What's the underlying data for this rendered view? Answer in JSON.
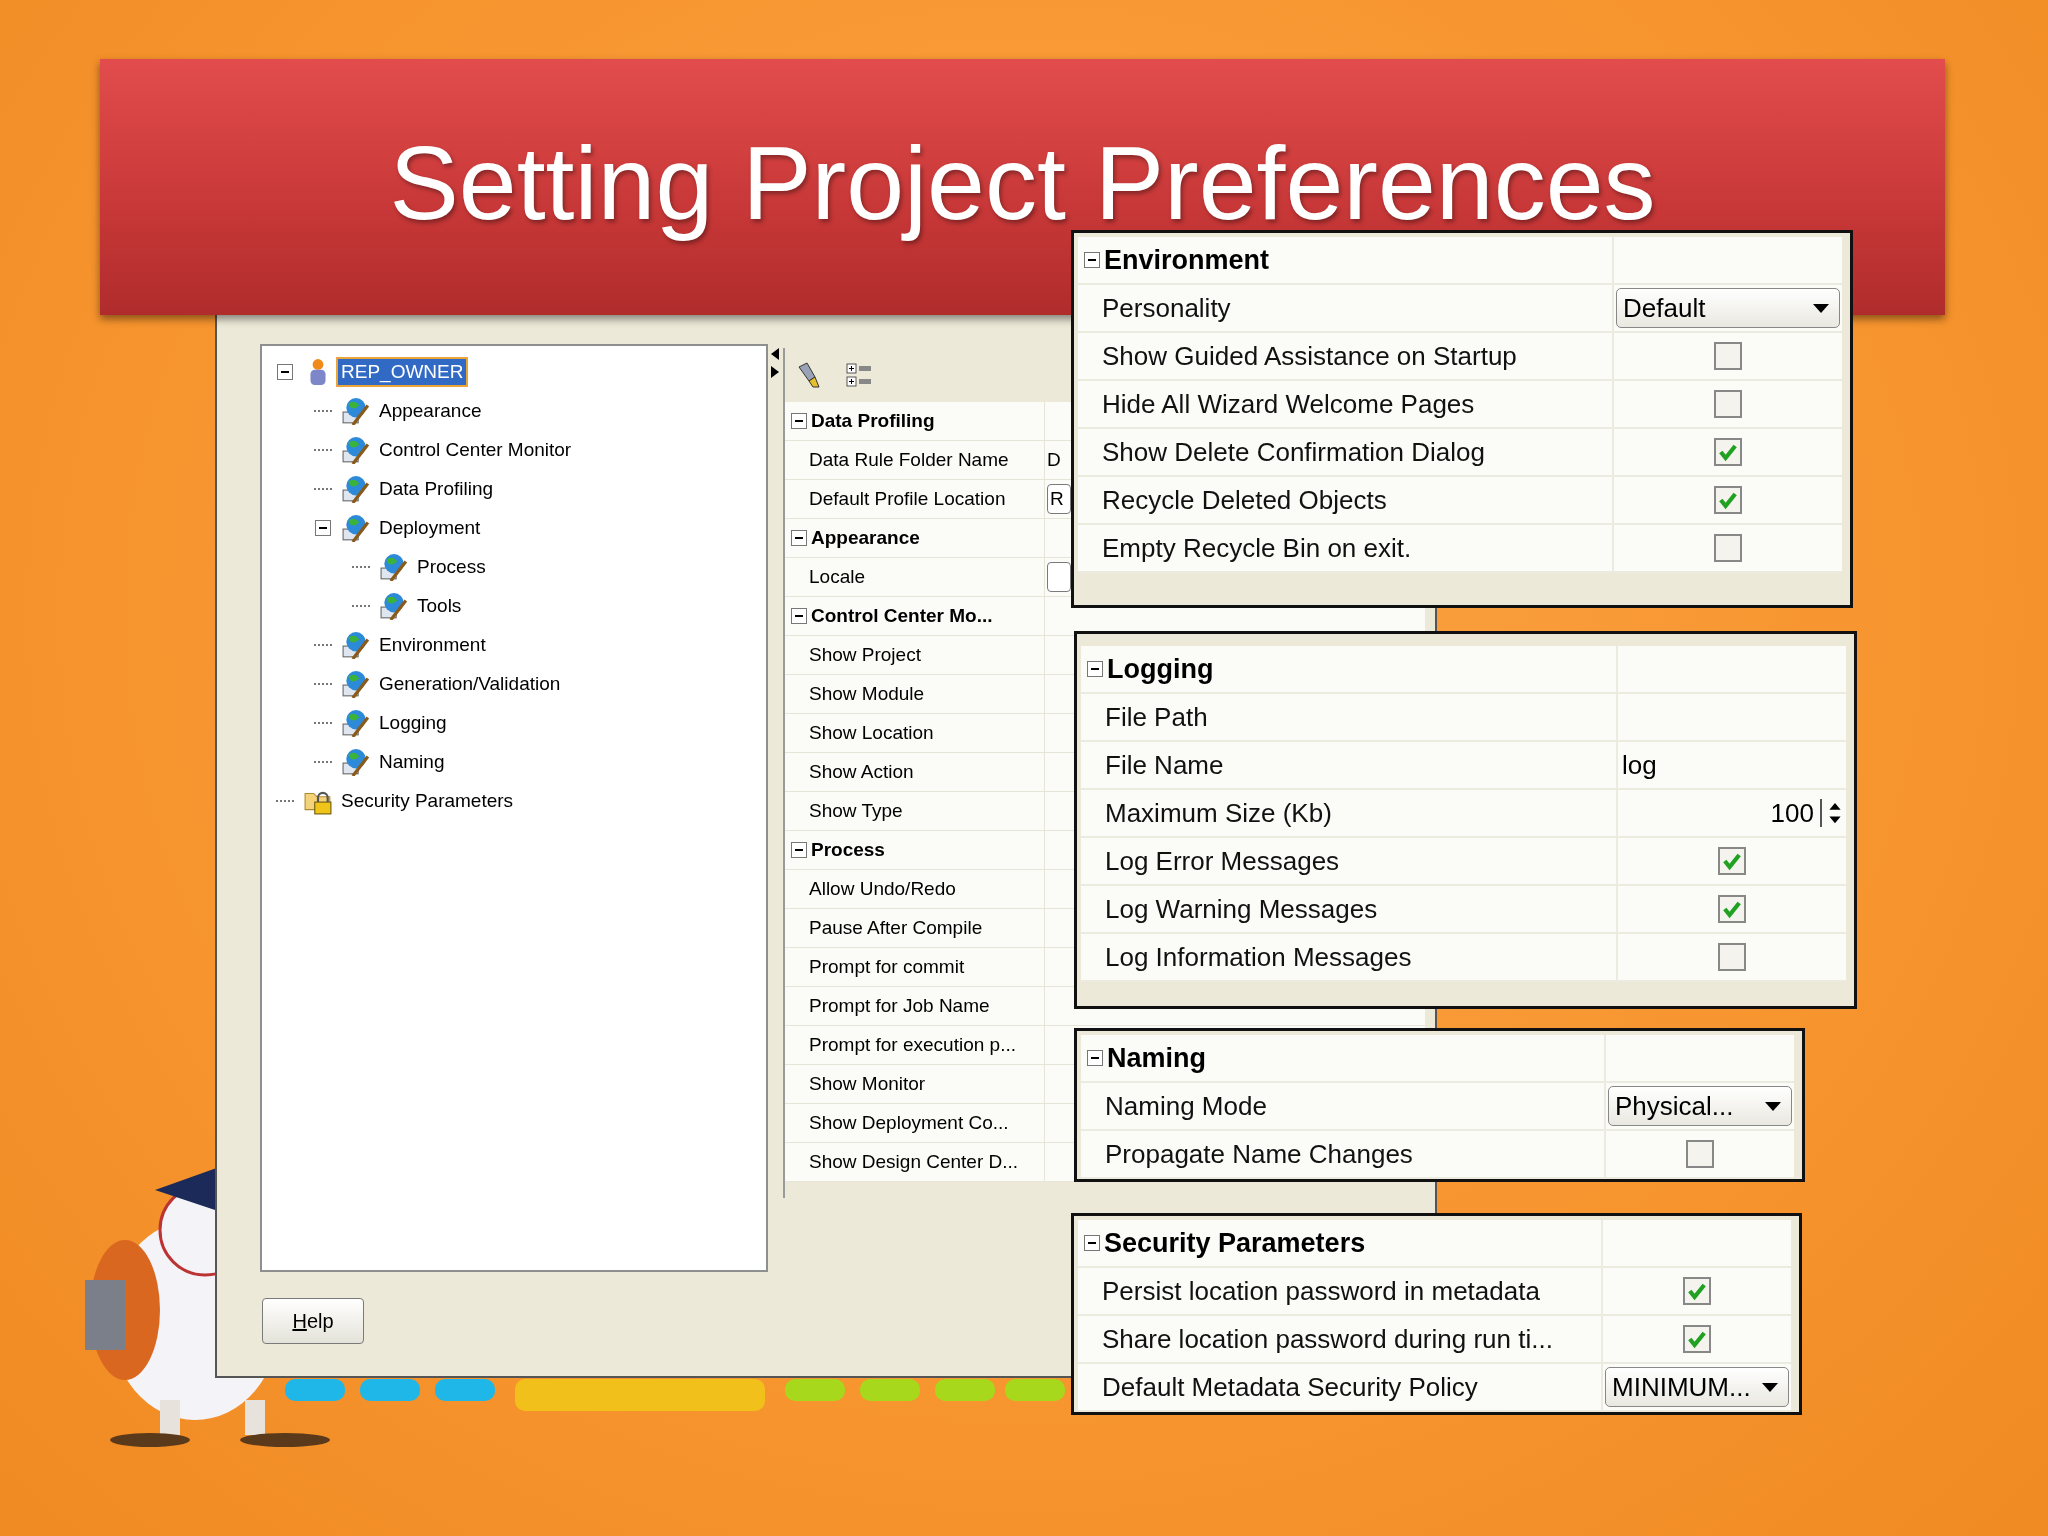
{
  "slide_title": "Setting Project Preferences",
  "dialog": {
    "tree": [
      {
        "label": "REP_OWNER",
        "kind": "user",
        "selected": true,
        "expanded": true,
        "children": [
          {
            "label": "Appearance",
            "kind": "category",
            "selected": false
          },
          {
            "label": "Control Center Monitor",
            "kind": "category",
            "selected": false
          },
          {
            "label": "Data Profiling",
            "kind": "category",
            "selected": false
          },
          {
            "label": "Deployment",
            "kind": "category",
            "selected": false,
            "expanded": true,
            "children": [
              {
                "label": "Process",
                "kind": "category",
                "selected": false
              },
              {
                "label": "Tools",
                "kind": "category",
                "selected": false
              }
            ]
          },
          {
            "label": "Environment",
            "kind": "category",
            "selected": false
          },
          {
            "label": "Generation/Validation",
            "kind": "category",
            "selected": false
          },
          {
            "label": "Logging",
            "kind": "category",
            "selected": false
          },
          {
            "label": "Naming",
            "kind": "category",
            "selected": false
          }
        ]
      },
      {
        "label": "Security Parameters",
        "kind": "folder",
        "selected": false
      }
    ],
    "grid": [
      {
        "title": "Data Profiling",
        "expanded": true,
        "rows": [
          {
            "kind": "text",
            "label": "Data Rule Folder Name",
            "value": "D"
          },
          {
            "kind": "field",
            "label": "Default Profile Location",
            "value": "R"
          }
        ]
      },
      {
        "title": "Appearance",
        "expanded": true,
        "rows": [
          {
            "kind": "field",
            "label": "Locale"
          }
        ]
      },
      {
        "title": "Control Center Mo...",
        "expanded": true,
        "rows": [
          {
            "kind": "blank",
            "label": "Show Project"
          },
          {
            "kind": "blank",
            "label": "Show Module"
          },
          {
            "kind": "blank",
            "label": "Show Location"
          },
          {
            "kind": "blank",
            "label": "Show Action"
          },
          {
            "kind": "blank",
            "label": "Show Type"
          }
        ]
      },
      {
        "title": "Process",
        "expanded": true,
        "rows": [
          {
            "kind": "blank",
            "label": "Allow Undo/Redo"
          },
          {
            "kind": "blank",
            "label": "Pause After Compile"
          },
          {
            "kind": "blank",
            "label": "Prompt for commit"
          },
          {
            "kind": "blank",
            "label": "Prompt for Job Name"
          },
          {
            "kind": "blank",
            "label": "Prompt for execution p..."
          },
          {
            "kind": "blank",
            "label": "Show Monitor"
          },
          {
            "kind": "blank",
            "label": "Show Deployment Co..."
          },
          {
            "kind": "blank",
            "label": "Show Design Center D..."
          }
        ]
      }
    ],
    "help_button": "Help"
  },
  "panels": [
    {
      "title": "Environment",
      "expanded": true,
      "rows": [
        {
          "kind": "dropdown",
          "label": "Personality",
          "value": "Default"
        },
        {
          "kind": "check",
          "label": "Show Guided Assistance on Startup",
          "checked": false
        },
        {
          "kind": "check",
          "label": "Hide All Wizard Welcome Pages",
          "checked": false
        },
        {
          "kind": "check",
          "label": "Show Delete Confirmation Dialog",
          "checked": true
        },
        {
          "kind": "check",
          "label": "Recycle Deleted Objects",
          "checked": true
        },
        {
          "kind": "check",
          "label": "Empty Recycle Bin on exit.",
          "checked": false
        }
      ]
    },
    {
      "title": "Logging",
      "expanded": true,
      "rows": [
        {
          "kind": "text",
          "label": "File Path"
        },
        {
          "kind": "text",
          "label": "File Name",
          "value": "log"
        },
        {
          "kind": "spinner",
          "label": "Maximum Size (Kb)",
          "value": "100"
        },
        {
          "kind": "check",
          "label": "Log Error Messages",
          "checked": true
        },
        {
          "kind": "check",
          "label": "Log Warning Messages",
          "checked": true
        },
        {
          "kind": "check",
          "label": "Log Information Messages",
          "checked": false
        }
      ]
    },
    {
      "title": "Naming",
      "expanded": true,
      "rows": [
        {
          "kind": "dropdown",
          "label": "Naming Mode",
          "value": "Physical..."
        },
        {
          "kind": "check",
          "label": "Propagate Name Changes",
          "checked": false
        }
      ]
    },
    {
      "title": "Security Parameters",
      "expanded": true,
      "rows": [
        {
          "kind": "check",
          "label": "Persist location password in metadata",
          "checked": true
        },
        {
          "kind": "check",
          "label": "Share location password during run ti...",
          "checked": true
        },
        {
          "kind": "dropdown",
          "label": "Default Metadata Security Policy",
          "value": "MINIMUM..."
        }
      ]
    }
  ]
}
